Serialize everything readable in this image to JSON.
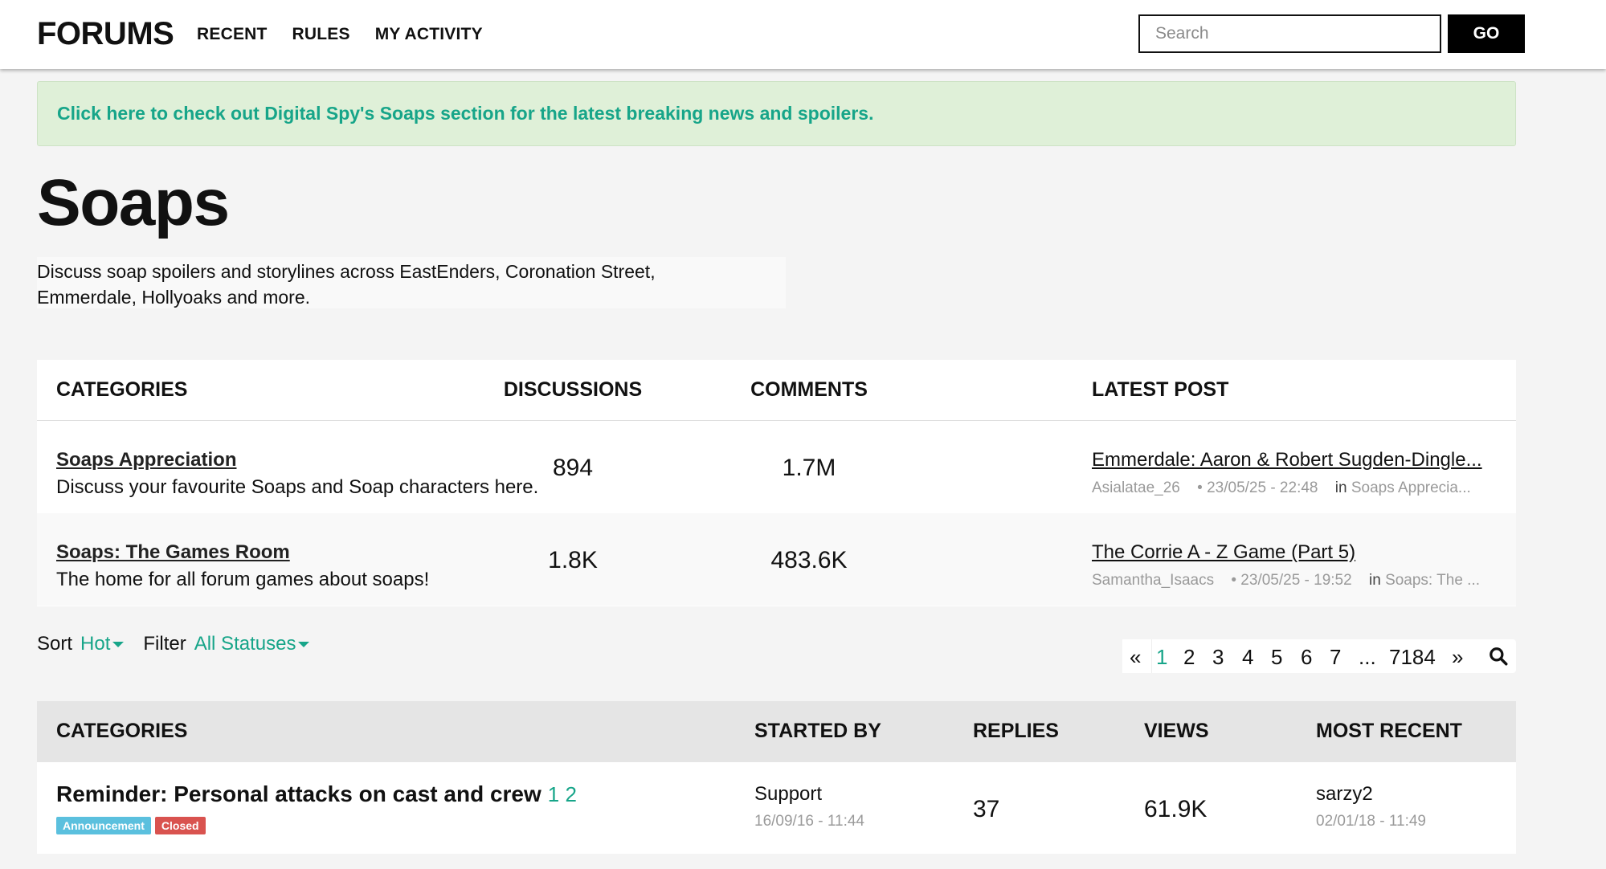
{
  "header": {
    "brand": "FORUMS",
    "nav": [
      "RECENT",
      "RULES",
      "MY ACTIVITY"
    ],
    "search_placeholder": "Search",
    "go_label": "GO"
  },
  "banner": {
    "text": "Click here to check out Digital Spy's Soaps section for the latest breaking news and spoilers."
  },
  "page": {
    "title": "Soaps",
    "description_line1": "Discuss soap spoilers and storylines across EastEnders, Coronation Street,",
    "description_line2": "Emmerdale, Hollyoaks and more."
  },
  "categories_table": {
    "headers": {
      "name": "CATEGORIES",
      "discussions": "DISCUSSIONS",
      "comments": "COMMENTS",
      "latest": "LATEST POST"
    },
    "rows": [
      {
        "title": "Soaps Appreciation",
        "description": "Discuss your favourite Soaps and Soap characters here.",
        "discussions": "894",
        "comments": "1.7M",
        "latest_title": "Emmerdale: Aaron & Robert Sugden-Dingle...",
        "latest_user": "Asialatae_26",
        "latest_time": "• 23/05/25 - 22:48",
        "latest_in_label": "in",
        "latest_in": "Soaps Apprecia..."
      },
      {
        "title": "Soaps: The Games Room",
        "description": "The home for all forum games about soaps!",
        "discussions": "1.8K",
        "comments": "483.6K",
        "latest_title": "The Corrie A - Z Game (Part 5)",
        "latest_user": "Samantha_Isaacs",
        "latest_time": "• 23/05/25 - 19:52",
        "latest_in_label": "in",
        "latest_in": "Soaps: The ..."
      }
    ]
  },
  "controls": {
    "sort_label": "Sort",
    "sort_value": "Hot",
    "filter_label": "Filter",
    "filter_value": "All Statuses"
  },
  "pagination": {
    "prev": "«",
    "pages": [
      "1",
      "2",
      "3",
      "4",
      "5",
      "6",
      "7"
    ],
    "ellipsis": "...",
    "last": "7184",
    "next": "»",
    "current": "1"
  },
  "discussions_table": {
    "headers": {
      "name": "CATEGORIES",
      "started_by": "STARTED BY",
      "replies": "REPLIES",
      "views": "VIEWS",
      "most_recent": "MOST RECENT"
    },
    "rows": [
      {
        "title": "Reminder: Personal attacks on cast and crew",
        "pages": "1 2",
        "badges": [
          "Announcement",
          "Closed"
        ],
        "started_by": "Support",
        "started_time": "16/09/16 - 11:44",
        "replies": "37",
        "views": "61.9K",
        "recent_user": "sarzy2",
        "recent_time": "02/01/18 - 11:49"
      }
    ]
  },
  "colors": {
    "accent": "#17a589",
    "banner_bg": "#dff0d8",
    "badge_announcement": "#5bc0de",
    "badge_closed": "#d9534f"
  }
}
